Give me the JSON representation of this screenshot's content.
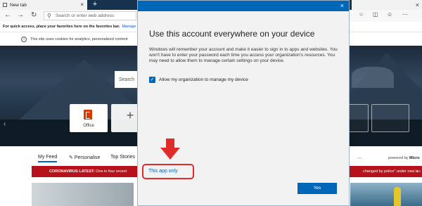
{
  "browser": {
    "tab_label": "New tab",
    "tab_close": "×",
    "new_tab": "+",
    "window_close": "×",
    "back": "←",
    "forward": "→",
    "refresh": "↻",
    "address_placeholder": "Search or enter web address",
    "favorites_bar_text": "For quick access, place your favorites here on the favorites bar.",
    "favorites_link": "Manage favorite",
    "cookie_notice": "This site uses cookies for analytics, personalized content"
  },
  "page": {
    "hero_search_placeholder": "Search",
    "tiles": [
      {
        "label": "Office"
      },
      {
        "label": "+"
      }
    ],
    "prev_arrow": "‹",
    "feed_tabs": [
      "My Feed",
      "Personalise",
      "Top Stories"
    ],
    "more": "...",
    "powered_by_prefix": "powered by",
    "powered_by_brand": "Micro",
    "ticker_label": "CORONAVIRUS LATEST:",
    "ticker_text": "One in four recent",
    "ticker_right": "changed by police\" under new la",
    "ticker_nav": "‹ ›"
  },
  "dialog": {
    "close": "×",
    "heading": "Use this account everywhere on your device",
    "body": "Windows will remember your account and make it easier to sign in to apps and websites. You won't have to enter your password each time you access your organization's resources. You may need to allow them to manage certain settings on your device.",
    "checkbox_label": "Allow my organization to manage my device",
    "checkbox_checked": true,
    "this_app_only": "This app only",
    "yes_label": "Yes"
  },
  "colors": {
    "accent": "#0067b8",
    "highlight": "#e02b2b",
    "ticker": "#b5121b"
  }
}
